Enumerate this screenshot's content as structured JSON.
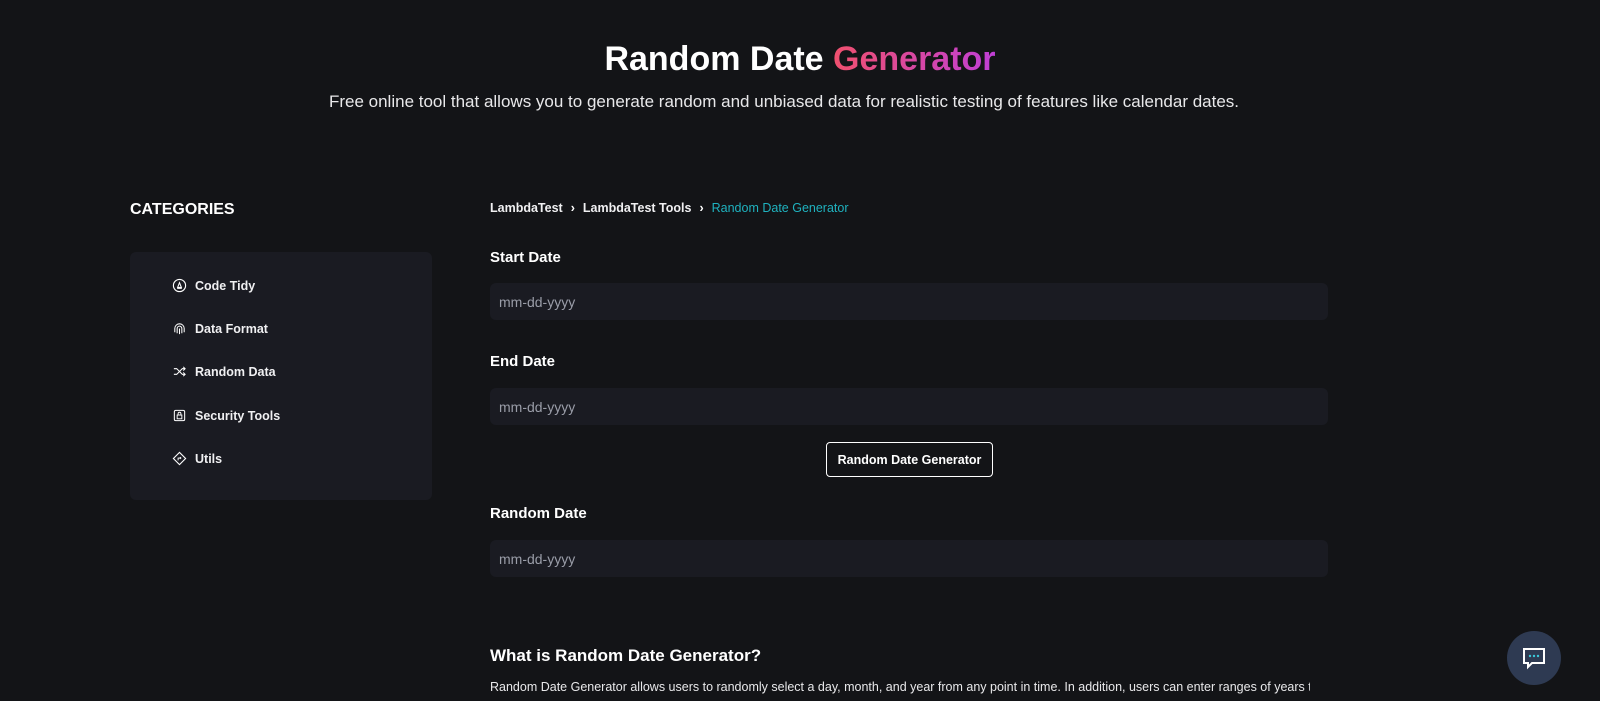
{
  "hero": {
    "title_plain": "Random Date ",
    "title_accent": "Generator",
    "subtitle": "Free online tool that allows you to generate random and unbiased data for realistic testing of features like calendar dates."
  },
  "sidebar": {
    "title": "CATEGORIES",
    "items": [
      {
        "label": "Code Tidy",
        "icon": "code-tidy-icon"
      },
      {
        "label": "Data Format",
        "icon": "fingerprint-icon"
      },
      {
        "label": "Random Data",
        "icon": "shuffle-icon"
      },
      {
        "label": "Security Tools",
        "icon": "lock-icon"
      },
      {
        "label": "Utils",
        "icon": "diamond-arrow-icon"
      }
    ]
  },
  "breadcrumb": {
    "items": [
      "LambdaTest",
      "LambdaTest Tools"
    ],
    "current": "Random Date Generator",
    "current_color": "#1fb2bf"
  },
  "form": {
    "start_label": "Start Date",
    "start_placeholder": "mm-dd-yyyy",
    "end_label": "End Date",
    "end_placeholder": "mm-dd-yyyy",
    "button_label": "Random Date Generator",
    "result_label": "Random Date",
    "result_placeholder": "mm-dd-yyyy"
  },
  "about": {
    "heading": "What is Random Date Generator?",
    "text": "Random Date Generator allows users to randomly select a day, month, and year from any point in time. In addition, users can enter ranges of years they"
  },
  "colors": {
    "accent_gradient_start": "#f0506e",
    "accent_gradient_end": "#c03fd6",
    "background": "#131417",
    "card": "#1a1b22"
  }
}
